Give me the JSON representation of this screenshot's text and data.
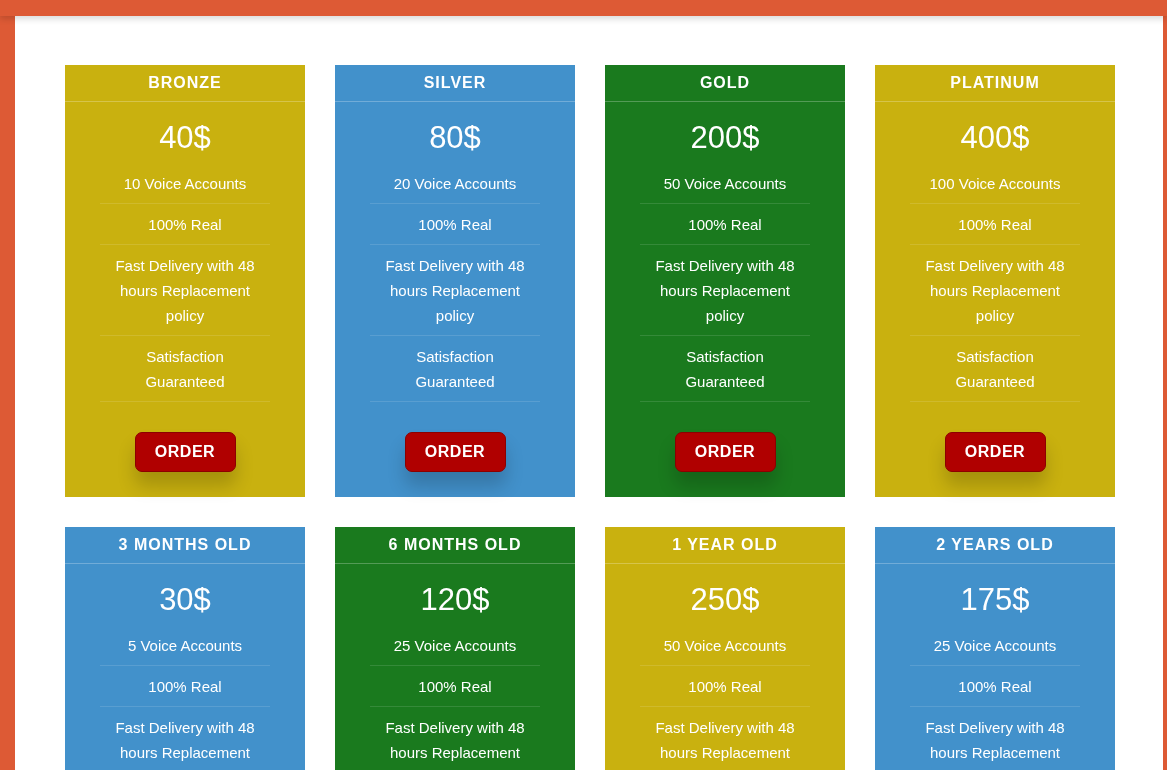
{
  "plans": [
    {
      "name": "BRONZE",
      "color": "#c9b10f",
      "price": "40$",
      "features": [
        "10 Voice Accounts",
        "100% Real",
        "Fast Delivery with 48 hours Replacement policy",
        "Satisfaction Guaranteed"
      ],
      "button": "ORDER"
    },
    {
      "name": "SILVER",
      "color": "#4291cb",
      "price": "80$",
      "features": [
        "20 Voice Accounts",
        "100% Real",
        "Fast Delivery with 48 hours Replacement policy",
        "Satisfaction Guaranteed"
      ],
      "button": "ORDER"
    },
    {
      "name": "GOLD",
      "color": "#1a7a1e",
      "price": "200$",
      "features": [
        "50 Voice Accounts",
        "100% Real",
        "Fast Delivery with 48 hours Replacement policy",
        "Satisfaction Guaranteed"
      ],
      "button": "ORDER"
    },
    {
      "name": "PLATINUM",
      "color": "#c9b10f",
      "price": "400$",
      "features": [
        "100 Voice Accounts",
        "100% Real",
        "Fast Delivery with 48 hours Replacement policy",
        "Satisfaction Guaranteed"
      ],
      "button": "ORDER"
    },
    {
      "name": "3 MONTHS OLD",
      "color": "#4291cb",
      "price": "30$",
      "features": [
        "5 Voice Accounts",
        "100% Real",
        "Fast Delivery with 48 hours Replacement"
      ]
    },
    {
      "name": "6 MONTHS OLD",
      "color": "#1a7a1e",
      "price": "120$",
      "features": [
        "25 Voice Accounts",
        "100% Real",
        "Fast Delivery with 48 hours Replacement"
      ]
    },
    {
      "name": "1 YEAR OLD",
      "color": "#c9b10f",
      "price": "250$",
      "features": [
        "50 Voice Accounts",
        "100% Real",
        "Fast Delivery with 48 hours Replacement"
      ]
    },
    {
      "name": "2 YEARS OLD",
      "color": "#4291cb",
      "price": "175$",
      "features": [
        "25 Voice Accounts",
        "100% Real",
        "Fast Delivery with 48 hours Replacement"
      ]
    }
  ]
}
